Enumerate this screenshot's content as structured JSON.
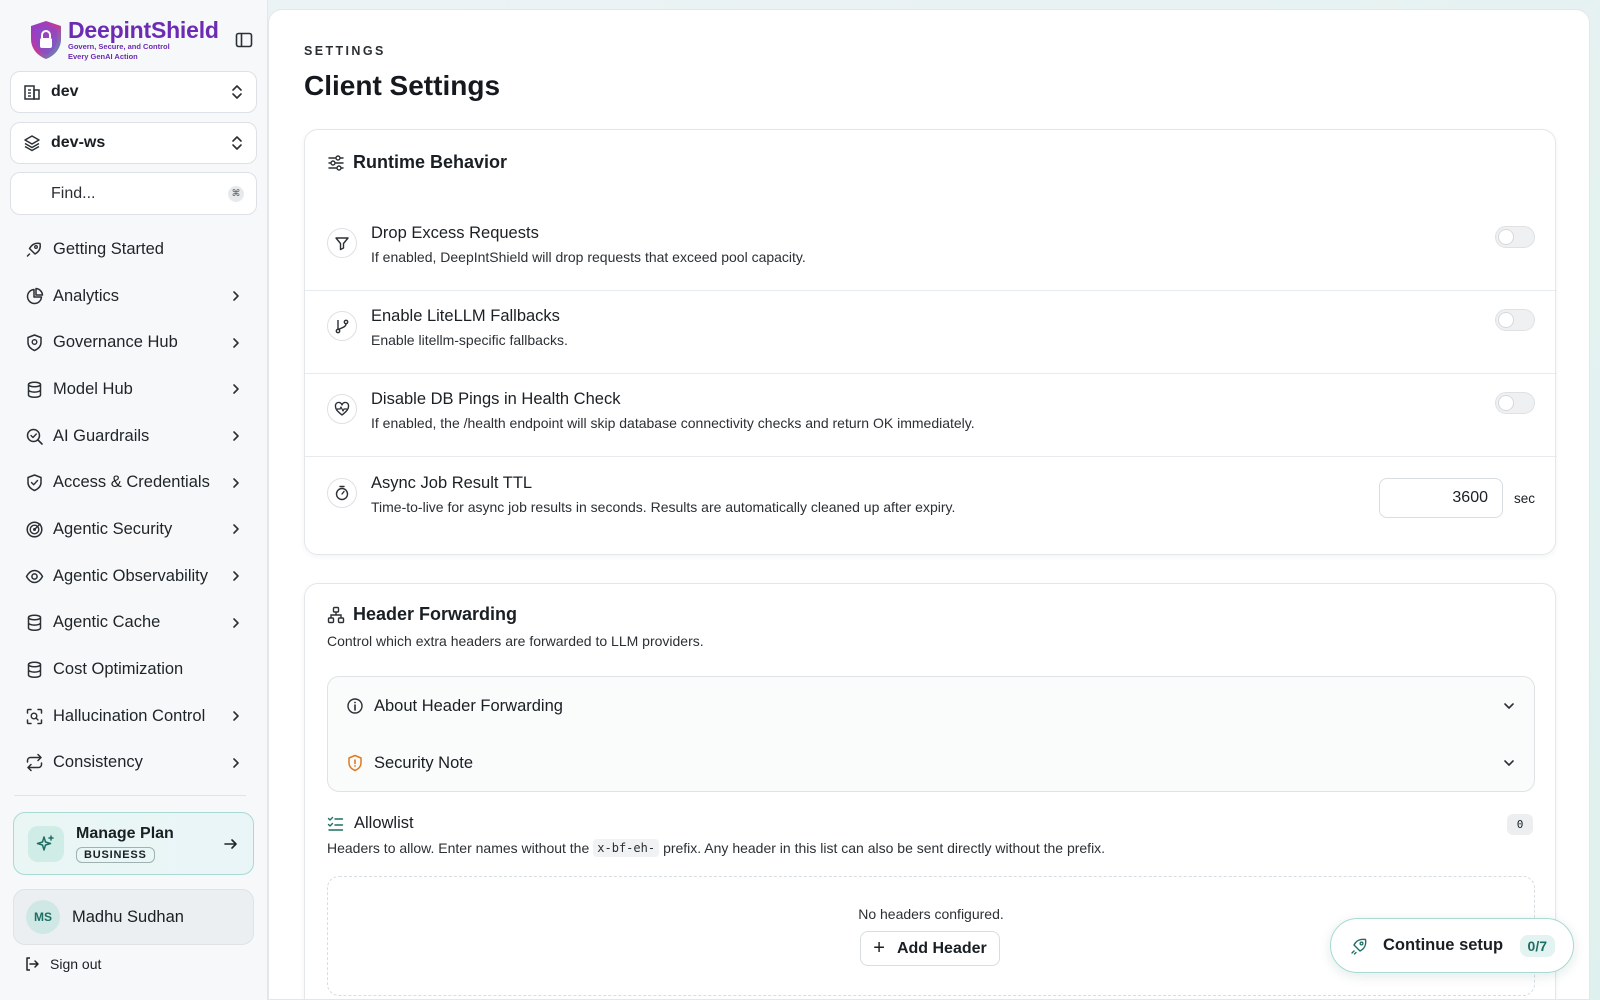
{
  "brand": {
    "name": "DeepintShield",
    "tagline_line1": "Govern, Secure, and Control",
    "tagline_line2": "Every GenAI Action"
  },
  "sidebar": {
    "org_select": "dev",
    "workspace_select": "dev-ws",
    "find_placeholder": "Find...",
    "find_shortcut": "⌘",
    "items": [
      {
        "label": "Getting Started",
        "icon": "rocket-icon",
        "has_submenu": false
      },
      {
        "label": "Analytics",
        "icon": "pie-chart-icon",
        "has_submenu": true
      },
      {
        "label": "Governance Hub",
        "icon": "shield-badge-icon",
        "has_submenu": true
      },
      {
        "label": "Model Hub",
        "icon": "database-icon",
        "has_submenu": true
      },
      {
        "label": "AI Guardrails",
        "icon": "search-check-icon",
        "has_submenu": true
      },
      {
        "label": "Access & Credentials",
        "icon": "shield-check-icon",
        "has_submenu": true
      },
      {
        "label": "Agentic Security",
        "icon": "radar-icon",
        "has_submenu": true
      },
      {
        "label": "Agentic Observability",
        "icon": "eye-icon",
        "has_submenu": true
      },
      {
        "label": "Agentic Cache",
        "icon": "database-icon",
        "has_submenu": true
      },
      {
        "label": "Cost Optimization",
        "icon": "database-icon",
        "has_submenu": false
      },
      {
        "label": "Hallucination Control",
        "icon": "scan-icon",
        "has_submenu": true
      },
      {
        "label": "Consistency",
        "icon": "repeat-icon",
        "has_submenu": true
      }
    ],
    "plan": {
      "title": "Manage Plan",
      "badge": "BUSINESS"
    },
    "user": {
      "initials": "MS",
      "name": "Madhu Sudhan"
    },
    "sign_out": "Sign out"
  },
  "page": {
    "breadcrumb": "SETTINGS",
    "title": "Client Settings"
  },
  "runtime": {
    "title": "Runtime Behavior",
    "rows": [
      {
        "title": "Drop Excess Requests",
        "desc": "If enabled, DeepIntShield will drop requests that exceed pool capacity.",
        "icon": "filter-icon",
        "enabled": false
      },
      {
        "title": "Enable LiteLLM Fallbacks",
        "desc": "Enable litellm-specific fallbacks.",
        "icon": "git-branch-icon",
        "enabled": false
      },
      {
        "title": "Disable DB Pings in Health Check",
        "desc": "If enabled, the /health endpoint will skip database connectivity checks and return OK immediately.",
        "icon": "heart-pulse-icon",
        "enabled": false
      },
      {
        "title": "Async Job Result TTL",
        "desc": "Time-to-live for async job results in seconds. Results are automatically cleaned up after expiry.",
        "icon": "timer-icon",
        "value": "3600",
        "unit": "sec"
      }
    ]
  },
  "header_forwarding": {
    "title": "Header Forwarding",
    "subtitle": "Control which extra headers are forwarded to LLM providers.",
    "accordion": [
      {
        "title": "About Header Forwarding",
        "icon": "info-icon"
      },
      {
        "title": "Security Note",
        "icon": "shield-alert-icon"
      }
    ],
    "allowlist": {
      "title": "Allowlist",
      "count": "0",
      "desc_before": "Headers to allow. Enter names without the",
      "desc_code": "x-bf-eh-",
      "desc_after": "prefix. Any header in this list can also be sent directly without the prefix.",
      "empty_text": "No headers configured.",
      "add_label": "Add Header"
    }
  },
  "setup": {
    "label": "Continue setup",
    "progress": "0/7"
  },
  "colors": {
    "brand_purple": "#6c2bb3",
    "accent_teal": "#1f6e64",
    "warning_orange": "#e07a1f"
  }
}
